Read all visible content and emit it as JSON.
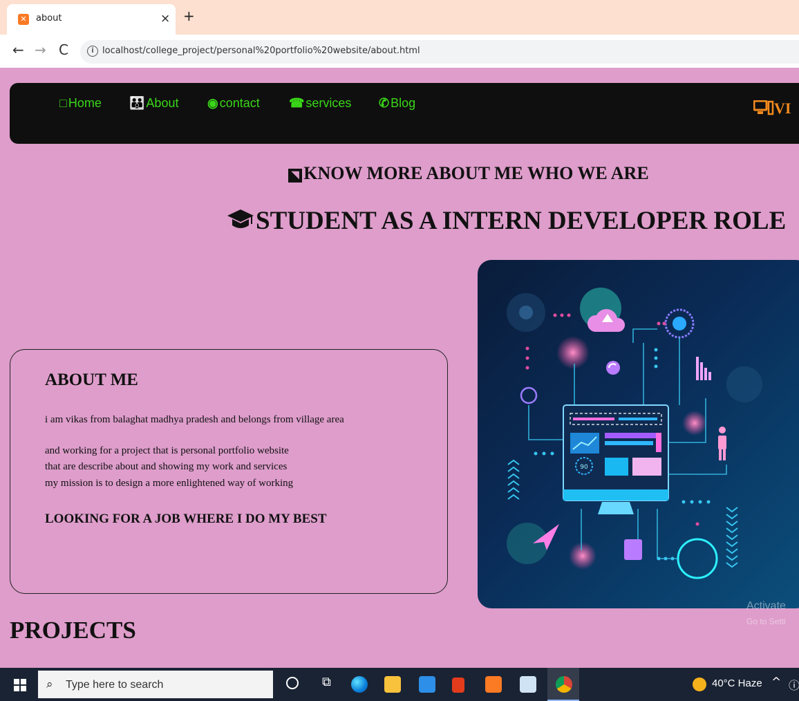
{
  "browser": {
    "tab": {
      "title": "about",
      "close": "×",
      "favicon": "xampp-icon"
    },
    "new_tab": "+",
    "nav": {
      "back": "←",
      "forward": "→",
      "reload": "C"
    },
    "url": "localhost/college_project/personal%20portfolio%20website/about.html"
  },
  "site_nav": {
    "items": [
      {
        "icon": "□",
        "label": "Home"
      },
      {
        "icon": "👪",
        "label": "About"
      },
      {
        "icon": "◉",
        "label": "contact"
      },
      {
        "icon": "☎",
        "label": "services"
      },
      {
        "icon": "✆",
        "label": "Blog"
      }
    ],
    "brand": "VI"
  },
  "colors": {
    "page_bg": "#de9dcb",
    "nav_bg": "#0f0f0f",
    "nav_link": "#3ad619",
    "brand": "#f28a1e"
  },
  "hero": {
    "subheading": "KNOW MORE ABOUT ME WHO WE ARE",
    "headline": "STUDENT AS A INTERN DEVELOPER ROLE"
  },
  "about": {
    "title": "ABOUT ME",
    "lines": [
      "i am vikas from balaghat madhya pradesh and belongs from village area",
      "and working for a project that is personal portfolio website",
      "that are describe about and showing my work and services",
      "my mission is to design a more enlightened way of working"
    ],
    "goal": "LOOKING FOR A JOB WHERE I DO MY BEST"
  },
  "projects": {
    "title": "PROJECTS"
  },
  "watermark": {
    "line1": "Activate",
    "line2": "Go to Setti"
  },
  "taskbar": {
    "search_placeholder": "Type here to search",
    "weather": "40°C  Haze",
    "tray_chevron": "^",
    "apps": [
      "cortana",
      "task-view",
      "edge",
      "file-explorer",
      "mail",
      "office",
      "xampp",
      "notepad",
      "chrome"
    ]
  }
}
